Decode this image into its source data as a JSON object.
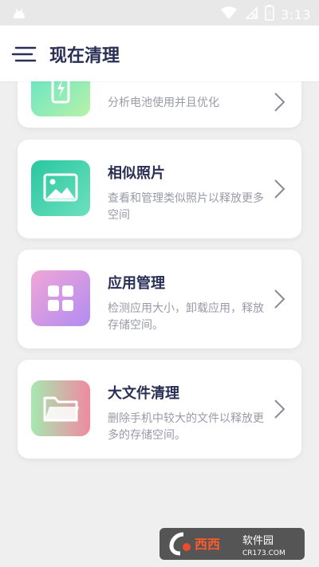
{
  "status_bar": {
    "time": "3:13",
    "icons": [
      "android-icon",
      "wifi-icon",
      "no-sim-icon",
      "battery-icon"
    ]
  },
  "app_bar": {
    "title": "现在清理",
    "menu_icon": "menu-icon"
  },
  "cards": [
    {
      "title": "",
      "desc": "分析电池使用并且优化",
      "icon": "battery-optimize-icon",
      "gradient": [
        "#5de4c8",
        "#b8f1a8"
      ]
    },
    {
      "title": "相似照片",
      "desc": "查看和管理类似照片以释放更多空间",
      "icon": "photo-icon",
      "gradient": [
        "#28c7a0",
        "#6ee0bf"
      ]
    },
    {
      "title": "应用管理",
      "desc": "检测应用大小，卸载应用，释放存储空间。",
      "icon": "app-grid-icon",
      "gradient": [
        "#f0a6d6",
        "#b28cf2"
      ]
    },
    {
      "title": "大文件清理",
      "desc": "删除手机中较大的文件以释放更多的存储空间。",
      "icon": "folder-icon",
      "gradient": [
        "#a6e8b0",
        "#f08aa0"
      ]
    }
  ],
  "watermark": {
    "brand": "西西软件园",
    "url": "CR173.COM"
  }
}
